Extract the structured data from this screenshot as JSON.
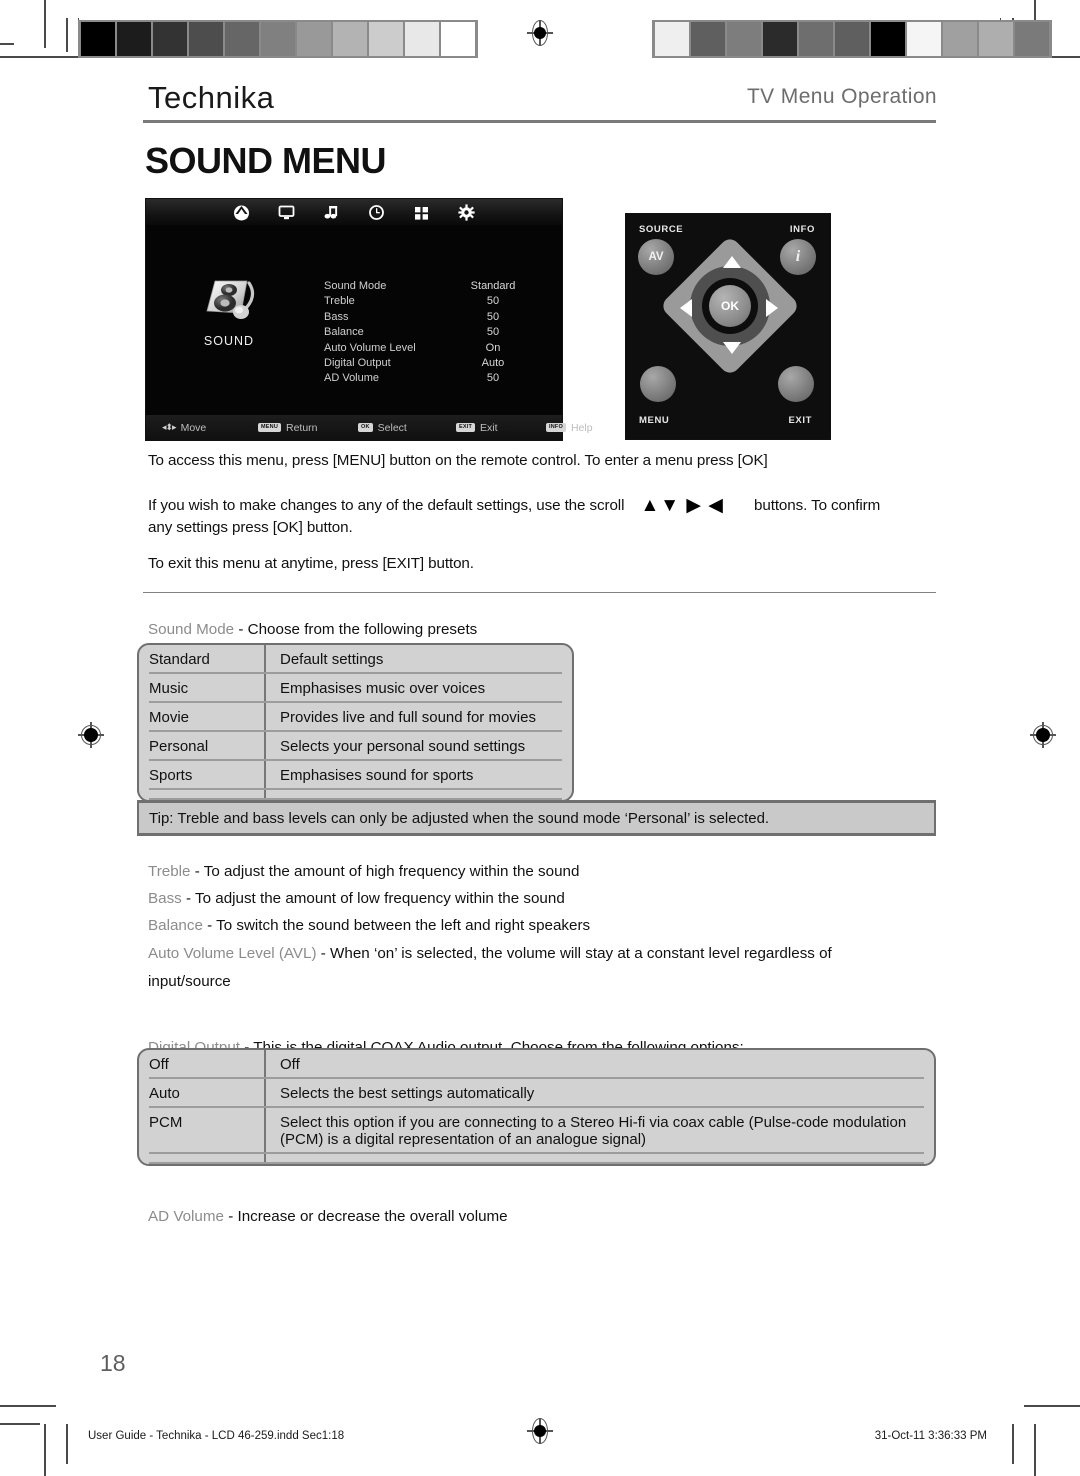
{
  "header": {
    "brand": "Technika",
    "section": "TV Menu Operation",
    "title": "SOUND MENU"
  },
  "osd": {
    "category_label": "SOUND",
    "top_icons": [
      {
        "name": "channel-icon",
        "selected": true
      },
      {
        "name": "picture-monitor-icon",
        "selected": false
      },
      {
        "name": "sound-note-icon",
        "selected": false
      },
      {
        "name": "time-clock-icon",
        "selected": false
      },
      {
        "name": "option-grid-icon",
        "selected": false
      },
      {
        "name": "setup-gear-icon",
        "selected": false
      }
    ],
    "rows": [
      {
        "label": "Sound Mode",
        "value": "Standard"
      },
      {
        "label": "Treble",
        "value": "50"
      },
      {
        "label": "Bass",
        "value": "50"
      },
      {
        "label": "Balance",
        "value": "50"
      },
      {
        "label": "Auto Volume Level",
        "value": "On"
      },
      {
        "label": "Digital Output",
        "value": "Auto"
      },
      {
        "label": "AD Volume",
        "value": "50"
      }
    ],
    "hints": [
      {
        "key": "",
        "label": "Move"
      },
      {
        "key": "MENU",
        "label": "Return"
      },
      {
        "key": "OK",
        "label": "Select"
      },
      {
        "key": "EXIT",
        "label": "Exit"
      },
      {
        "key": "INFO",
        "label": "Help"
      }
    ]
  },
  "remote": {
    "source_label": "SOURCE",
    "info_label": "INFO",
    "av_label": "AV",
    "info_glyph": "i",
    "ok_label": "OK",
    "menu_label": "MENU",
    "exit_label": "EXIT"
  },
  "intro": {
    "line1": "To access this menu, press [MENU] button on the remote control. To enter a menu press [OK]",
    "line2_a": "If you wish to make changes to any of the default settings, use the scroll",
    "line2_glyphs": "▲▼ ▶ ◀",
    "line2_b": "buttons. To confirm",
    "line2_c": "any settings press [OK] button.",
    "line3": "To exit this menu at anytime, press [EXIT] button."
  },
  "sound_mode": {
    "heading_term": "Sound Mode",
    "heading_rest": " - Choose from the following presets",
    "rows": [
      {
        "key": "Standard",
        "value": "Default settings"
      },
      {
        "key": "Music",
        "value": "Emphasises music over voices"
      },
      {
        "key": "Movie",
        "value": "Provides live and full sound for movies"
      },
      {
        "key": "Personal",
        "value": "Selects your personal sound settings"
      },
      {
        "key": "Sports",
        "value": "Emphasises sound for sports"
      }
    ]
  },
  "tip": {
    "text": "Tip: Treble and bass levels can only be adjusted when the sound mode ‘Personal’ is selected."
  },
  "definitions": [
    {
      "term": "Treble",
      "rest": " - To adjust the amount of high frequency within the sound"
    },
    {
      "term": "Bass",
      "rest": " - To adjust the amount of low frequency within the sound"
    },
    {
      "term": "Balance",
      "rest": " - To switch the sound between the left and right speakers"
    },
    {
      "term": "Auto Volume Level (AVL)",
      "rest": " - When ‘on’ is selected, the volume will stay at a constant level regardless of"
    }
  ],
  "definitions_wrap": "input/source",
  "digital_output": {
    "heading_term": "Digital Output",
    "heading_rest": " - This is the digital COAX Audio output. Choose from the following options:",
    "rows": [
      {
        "key": "Off",
        "value": "Off"
      },
      {
        "key": "Auto",
        "value": "Selects the best settings automatically"
      },
      {
        "key": "PCM",
        "value": "Select this option if you are connecting to a Stereo Hi-fi via coax cable (Pulse-code modulation (PCM) is a digital representation of an analogue signal)"
      }
    ]
  },
  "ad_volume": {
    "term": "AD Volume",
    "rest": " - Increase or decrease the overall volume"
  },
  "footer": {
    "page_number": "18",
    "file_info": "User Guide - Technika - LCD 46-259.indd   Sec1:18",
    "timestamp": "31-Oct-11   3:36:33 PM"
  },
  "swatches": {
    "left": [
      "#000000",
      "#1c1c1c",
      "#333333",
      "#4d4d4d",
      "#666666",
      "#808080",
      "#999999",
      "#b3b3b3",
      "#cccccc",
      "#e8e8e8",
      "#ffffff"
    ],
    "right": [
      "#efefef",
      "#5f5f5f",
      "#7d7d7d",
      "#2b2b2b",
      "#6e6e6e",
      "#5f5f5f",
      "#000000",
      "#f5f5f5",
      "#a0a0a0",
      "#aeaeae",
      "#7a7a7a"
    ]
  },
  "colors": {
    "rule": "#7a7a7a",
    "table_bg": "#d2d2d2",
    "table_border": "#6f6f6f",
    "term_grey": "#8c8c8c",
    "osd_bg": "#050505"
  }
}
